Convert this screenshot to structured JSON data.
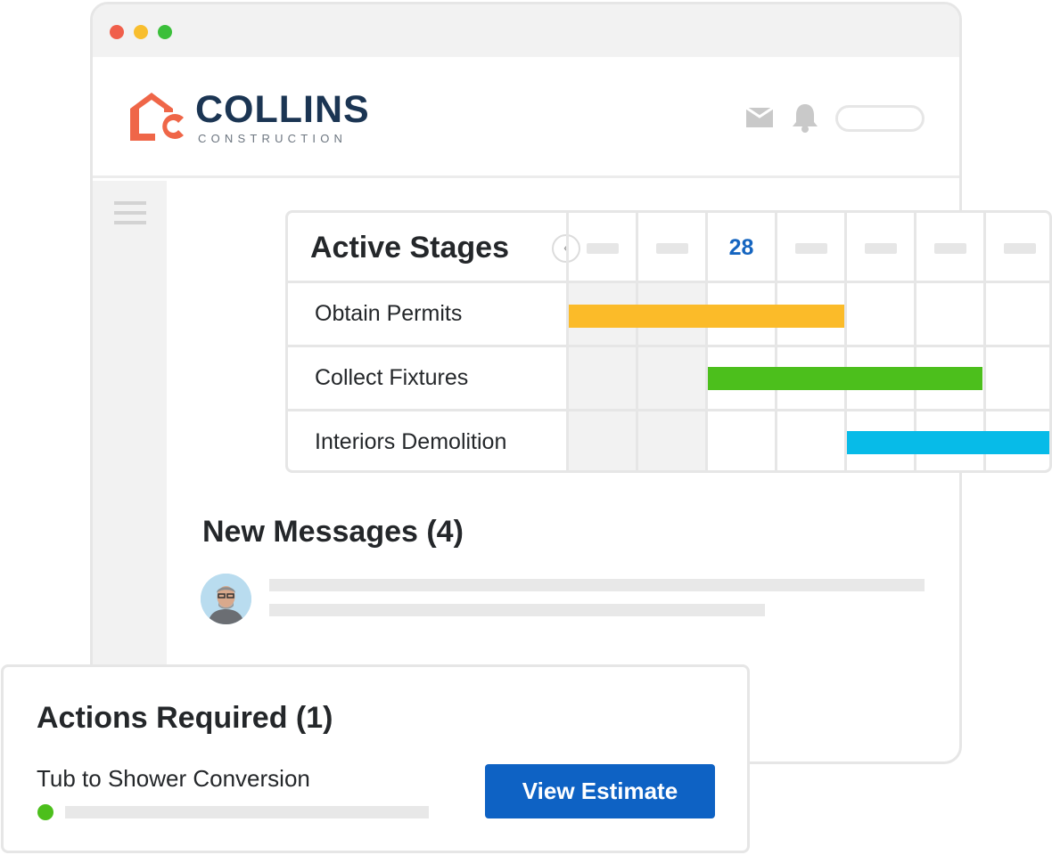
{
  "brand": {
    "name": "COLLINS",
    "subtitle": "CONSTRUCTION",
    "accent_color": "#ef6648",
    "navy_color": "#1b3553"
  },
  "header": {
    "icons": [
      "mail-icon",
      "bell-icon"
    ]
  },
  "gantt": {
    "title": "Active Stages",
    "current_day": "28",
    "stages": [
      {
        "label": "Obtain Permits",
        "color": "#fbbb29"
      },
      {
        "label": "Collect Fixtures",
        "color": "#4cbf1c"
      },
      {
        "label": "Interiors Demolition",
        "color": "#07bbe8"
      }
    ]
  },
  "messages": {
    "title": "New Messages (4)"
  },
  "actions": {
    "title": "Actions Required (1)",
    "item_label": "Tub to Shower Conversion",
    "button_label": "View Estimate",
    "status_color": "#4cbf1c"
  }
}
